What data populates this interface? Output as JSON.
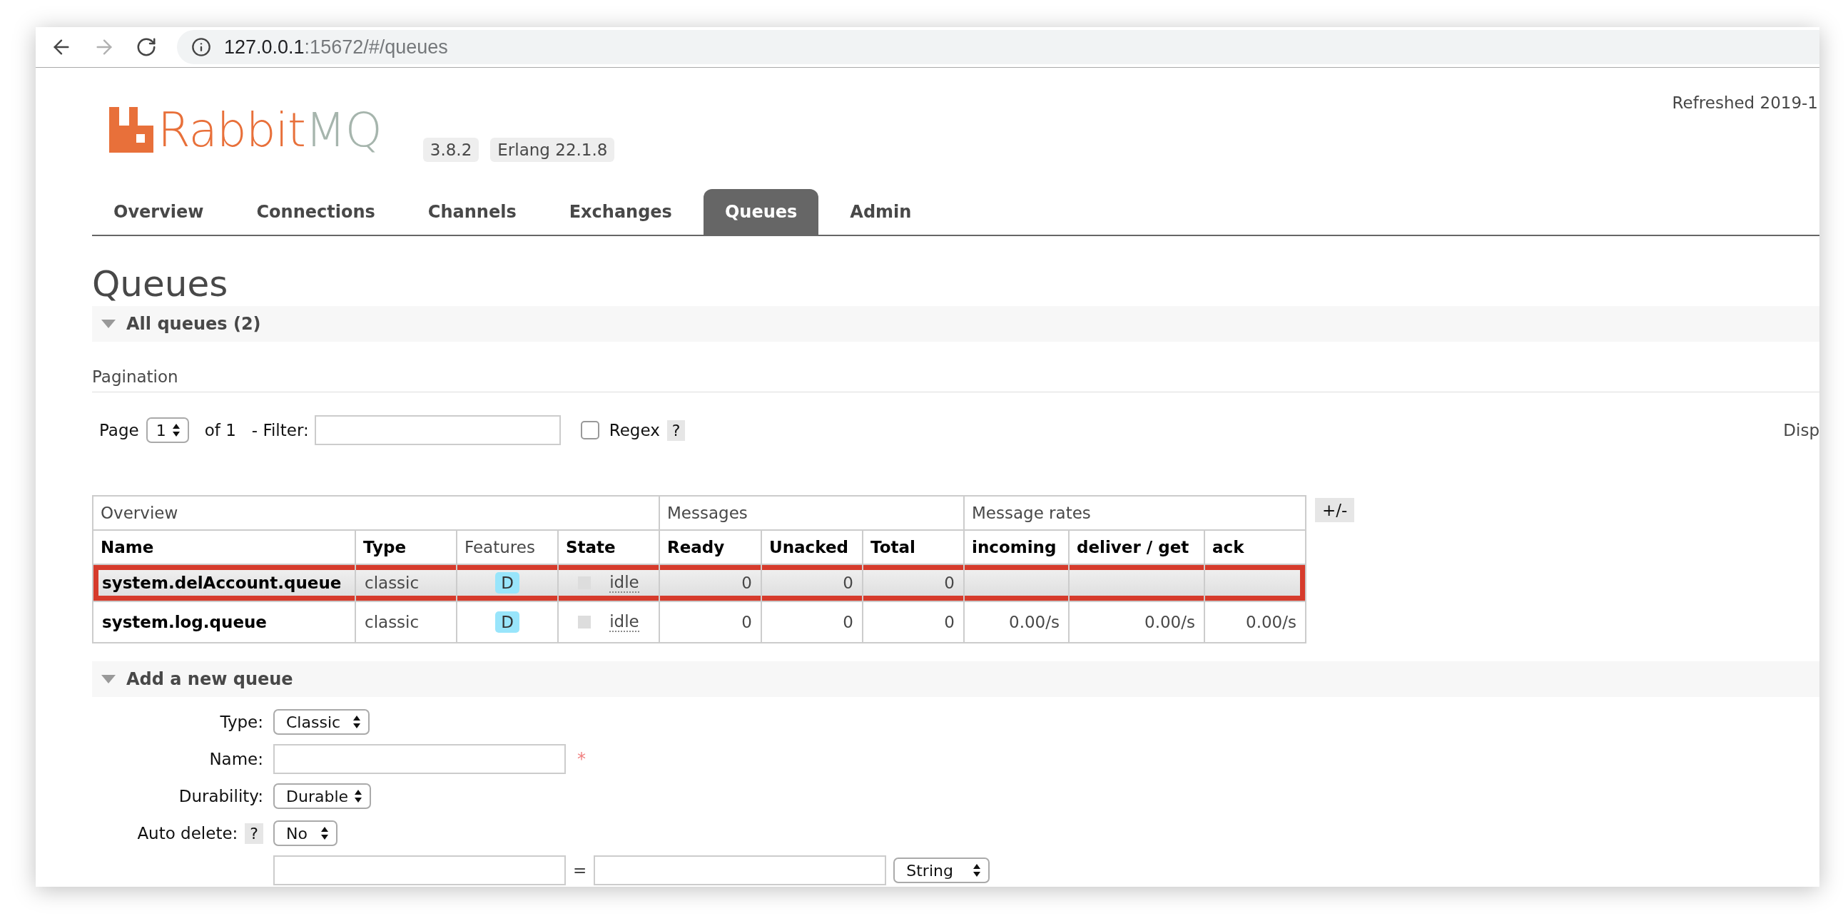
{
  "browser": {
    "url_host": "127.0.0.1",
    "url_rest": ":15672/#/queues",
    "forward_disabled": true
  },
  "header": {
    "logo_word1": "Rabbit",
    "logo_word2": "MQ",
    "version": "3.8.2",
    "erlang": "Erlang 22.1.8",
    "refreshed": "Refreshed 2019-1"
  },
  "tabs": [
    {
      "label": "Overview",
      "selected": false
    },
    {
      "label": "Connections",
      "selected": false
    },
    {
      "label": "Channels",
      "selected": false
    },
    {
      "label": "Exchanges",
      "selected": false
    },
    {
      "label": "Queues",
      "selected": true
    },
    {
      "label": "Admin",
      "selected": false
    }
  ],
  "title": "Queues",
  "all_queues": {
    "label": "All queues (2)",
    "expanded": true
  },
  "pagination": {
    "heading": "Pagination",
    "page_label": "Page",
    "page": "1",
    "of": "of 1",
    "filter_label": "- Filter:",
    "regex_label": "Regex",
    "regex_checked": false,
    "help": "?",
    "display": "Disp"
  },
  "table": {
    "toggle": "+/-",
    "groups": [
      {
        "label": "Overview",
        "columns": [
          {
            "label": "Name",
            "sortable": true,
            "kind": "name"
          },
          {
            "label": "Type",
            "sortable": true,
            "kind": "text"
          },
          {
            "label": "Features",
            "sortable": false,
            "kind": "badge"
          },
          {
            "label": "State",
            "sortable": true,
            "kind": "state"
          }
        ]
      },
      {
        "label": "Messages",
        "columns": [
          {
            "label": "Ready",
            "sortable": true,
            "kind": "number"
          },
          {
            "label": "Unacked",
            "sortable": true,
            "kind": "number"
          },
          {
            "label": "Total",
            "sortable": true,
            "kind": "number"
          }
        ]
      },
      {
        "label": "Message rates",
        "columns": [
          {
            "label": "incoming",
            "sortable": true,
            "kind": "number"
          },
          {
            "label": "deliver / get",
            "sortable": true,
            "kind": "number"
          },
          {
            "label": "ack",
            "sortable": true,
            "kind": "number"
          }
        ]
      }
    ],
    "rows": [
      {
        "cells": [
          "system.delAccount.queue",
          "classic",
          "D",
          "idle",
          "0",
          "0",
          "0"
        ],
        "selected": true,
        "annotated": true
      },
      {
        "cells": [
          "system.log.queue",
          "classic",
          "D",
          "idle",
          "0",
          "0",
          "0",
          "0.00/s",
          "0.00/s",
          "0.00/s"
        ],
        "selected": false,
        "annotated": false
      }
    ]
  },
  "add_queue": {
    "label": "Add a new queue",
    "expanded": true,
    "fields": [
      {
        "kind": "select",
        "label": "Type:",
        "value": "Classic"
      },
      {
        "kind": "text",
        "label": "Name:",
        "required_mark": "*"
      },
      {
        "kind": "select",
        "label": "Durability:",
        "value": "Durable"
      },
      {
        "kind": "select",
        "label": "Auto delete:",
        "help": "?",
        "value": "No"
      },
      {
        "kind": "pair",
        "separator": "=",
        "value": "String"
      }
    ]
  }
}
